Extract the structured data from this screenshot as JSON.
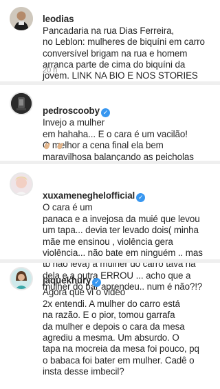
{
  "comments": [
    {
      "username": "leodias",
      "verified": false,
      "first_line": "Pancadaria na rua Dias Ferreira,",
      "rest": "no Leblon: mulheres de biquíni em carro\nconversível brigam na rua e homem\narranca parte de cima do biquíni da\njovem. LINK NA BIO E NOS STORIES",
      "time": "20 h"
    },
    {
      "username": "pedroscooby",
      "verified": true,
      "first_line": "Invejo a mulher",
      "rest": "em hahaha... E o cara é um vacilão!\nO melhor a cena final ela bem\nmaravilhosa balançando as peicholas",
      "reaction_icons": [
        "clapping-hands-icon",
        "clapping-hands-icon"
      ]
    },
    {
      "username": "xuxameneghelofficial",
      "verified": true,
      "first_line": "O cara é um",
      "rest": "panaca e a invejosa da muié que levou\num tapa... devia ter levado  dois( minha\nmãe me ensinou , violência gera\nviolência... não bate em ninguém .. mas\ntb não leva) a mulher do carro  tava na\ndela e a outra ERROU ... acho que  a\nmulher do bar aprendeu.. num é não?!?"
    },
    {
      "username": "jaquekhury",
      "verified": true,
      "first_line": "Agora que vi o video",
      "rest": "2x entendi. A mulher do carro está\nna razão. E o pior, tomou garrafa\nda mulher e depois o cara da mesa\nagrediu a mesma.  Um absurdo.  O\ntapa na mocreia da mesa foi pouco, pq\no babaca foi bater em mulher. Cadê o\ninsta desse imbecil?"
    }
  ],
  "colors": {
    "verified_blue": "#3897f0",
    "muted_text": "#8e8e8e",
    "divider": "#efefef"
  }
}
